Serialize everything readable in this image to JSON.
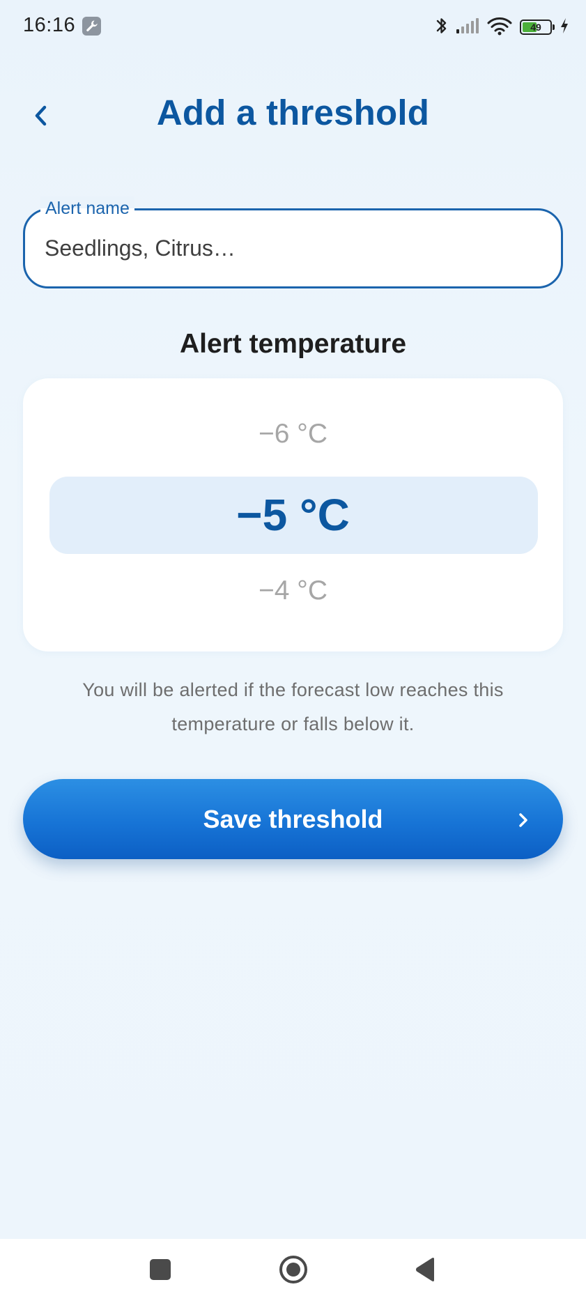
{
  "status_bar": {
    "time": "16:16",
    "battery_level": "49",
    "icons": [
      "wrench-icon",
      "bluetooth-icon",
      "signal-icon",
      "wifi-icon",
      "battery-icon",
      "charging-icon"
    ]
  },
  "header": {
    "title": "Add a threshold",
    "back_icon": "chevron-left-icon"
  },
  "alert_name": {
    "label": "Alert name",
    "placeholder": "Seedlings, Citrus…",
    "value": ""
  },
  "temperature": {
    "section_title": "Alert temperature",
    "options": [
      "−6 °C",
      "−5 °C",
      "−4 °C"
    ],
    "selected": "−5 °C",
    "helper_text": "You will be alerted if the forecast low reaches this temperature or falls below it."
  },
  "save": {
    "label": "Save threshold",
    "icon": "chevron-right-icon"
  },
  "nav": {
    "icons": [
      "recents-icon",
      "home-icon",
      "back-icon"
    ]
  },
  "colors": {
    "primary": "#0c57a0",
    "accent_button": "#1774d6",
    "selection_band": "#e2eefa",
    "background": "#eaf3fb"
  }
}
